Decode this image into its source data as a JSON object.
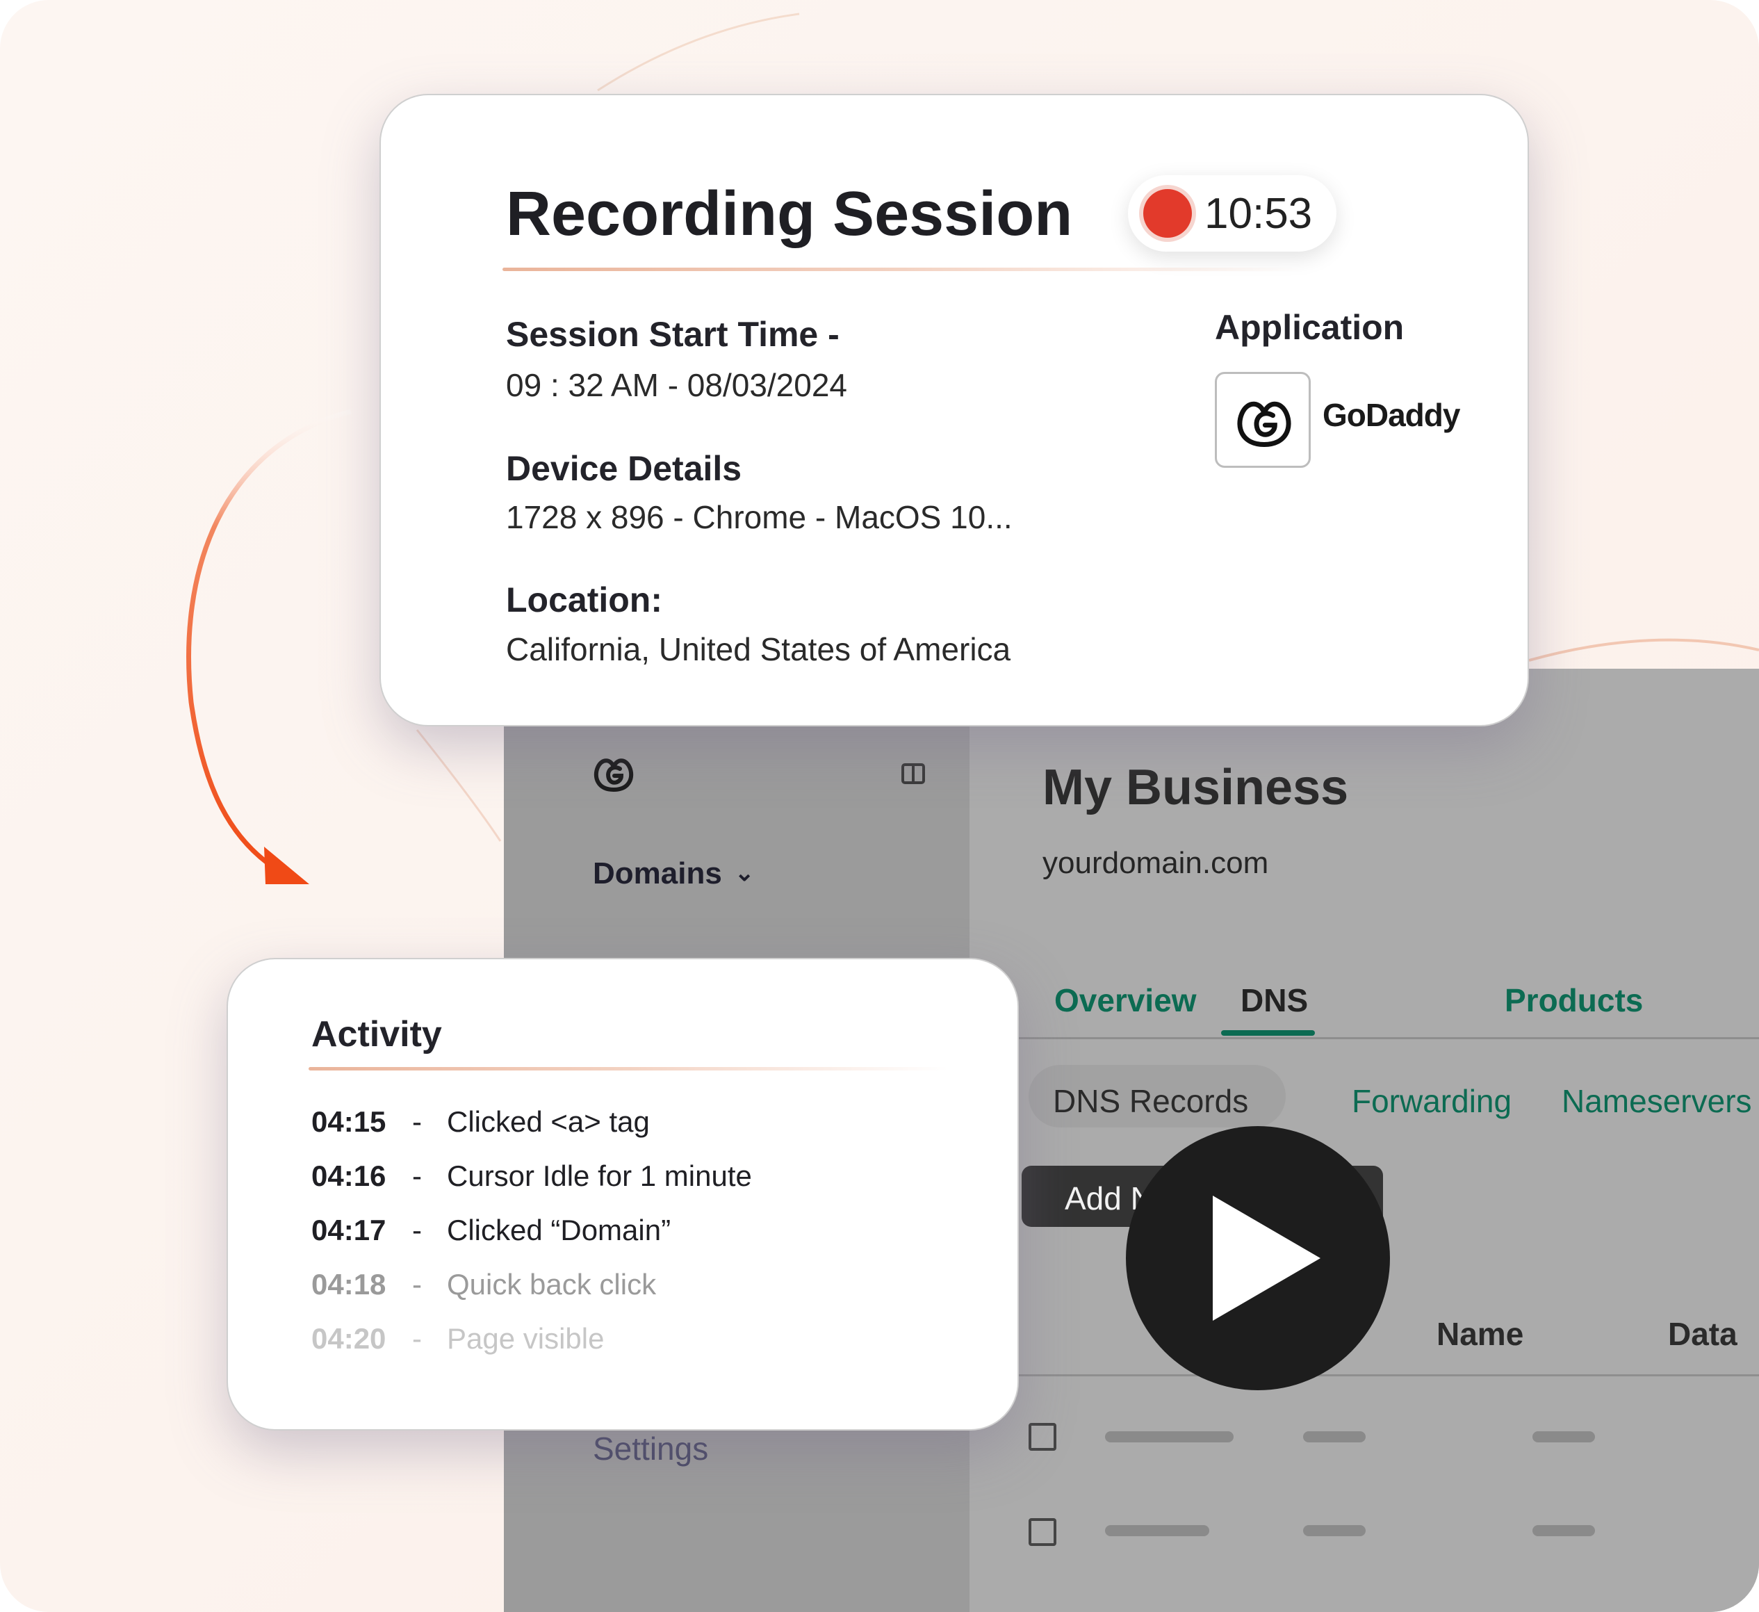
{
  "recording": {
    "title": "Recording Session",
    "timer": "10:53",
    "start_time_label": "Session Start Time -",
    "start_time_value": "09 : 32 AM  -  08/03/2024",
    "device_label": "Device Details",
    "device_value": "1728 x 896 - Chrome - MacOS 10...",
    "location_label": "Location:",
    "location_value": "California, United States of America",
    "application_label": "Application",
    "application_name": "GoDaddy",
    "application_icon": "godaddy-logo",
    "record_color": "#e23a2b"
  },
  "activity": {
    "title": "Activity",
    "items": [
      {
        "time": "04:15",
        "sep": "-",
        "text": "Clicked <a> tag",
        "color": "#1f1f24"
      },
      {
        "time": "04:16",
        "sep": "-",
        "text": "Cursor Idle for 1 minute",
        "color": "#1f1f24"
      },
      {
        "time": "04:17",
        "sep": "-",
        "text": "Clicked “Domain”",
        "color": "#1f1f24"
      },
      {
        "time": "04:18",
        "sep": "-",
        "text": "Quick back click",
        "color": "#9a9a9a"
      },
      {
        "time": "04:20",
        "sep": "-",
        "text": "Page visible",
        "color": "#c6c6c6"
      }
    ]
  },
  "app": {
    "sidebar": {
      "logo_icon": "godaddy-logo",
      "toggle_icon": "sidebar-toggle-icon",
      "domains_label": "Domains",
      "settings_label": "Settings"
    },
    "header": {
      "title": "My Business",
      "domain": "yourdomain.com"
    },
    "tabs": [
      {
        "label": "Overview",
        "active": false
      },
      {
        "label": "DNS",
        "active": true
      },
      {
        "label": "Products",
        "active": false
      }
    ],
    "subtabs": [
      {
        "label": "DNS  Records",
        "active": true
      },
      {
        "label": "Forwarding",
        "active": false
      },
      {
        "label": "Nameservers",
        "active": false
      }
    ],
    "add_button_label": "Add New Record",
    "columns": [
      "Name",
      "Data"
    ],
    "accent_color": "#0c6b52"
  },
  "player": {
    "icon": "play-icon"
  }
}
